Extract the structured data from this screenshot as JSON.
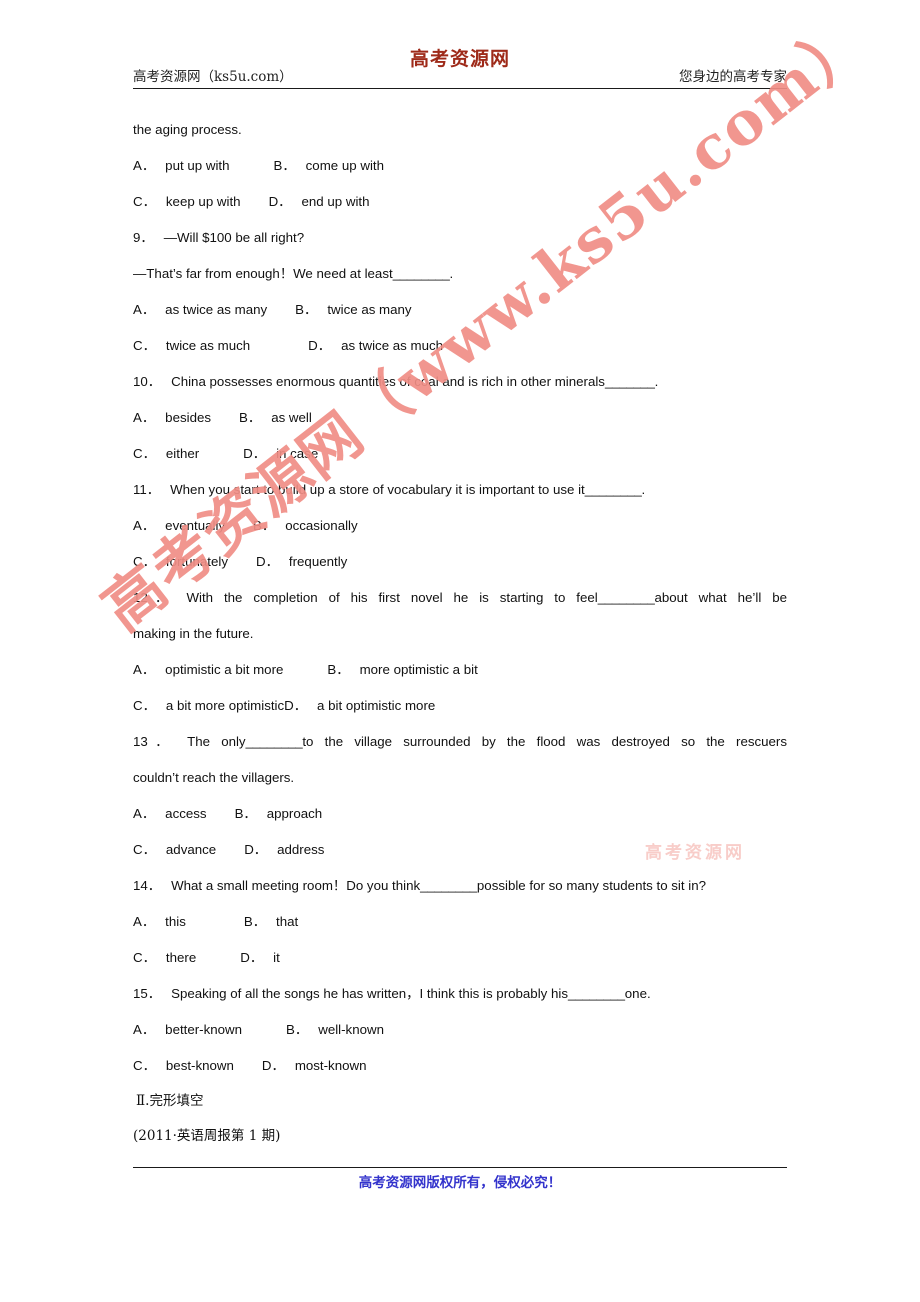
{
  "header": {
    "left_text": "高考资源网（ks5u.com）",
    "logo_text": "高考资源网",
    "right_text": "您身边的高考专家",
    "logo_color": "#9e2a19"
  },
  "watermark": {
    "main_text": "高考资源网（www.ks5u.com）",
    "faint_text": "高考资源网",
    "color": "#f08e86"
  },
  "content": {
    "carryover_line": "the aging process.",
    "questions": [
      {
        "number": "",
        "stem": "",
        "options": [
          {
            "label": "A．",
            "text": "put up with"
          },
          {
            "label": "B．",
            "text": "come up with"
          },
          {
            "label": "C．",
            "text": "keep up with"
          },
          {
            "label": "D．",
            "text": "end up with"
          }
        ]
      },
      {
        "number": "9．",
        "stem_line1": "—Will $100 be all right?",
        "stem_line2_a": "—That’s far from enough！We need at least",
        "stem_line2_blank": "________",
        "stem_line2_b": ".",
        "options": [
          {
            "label": "A．",
            "text": "as twice as many"
          },
          {
            "label": "B．",
            "text": "twice as many"
          },
          {
            "label": "C．",
            "text": "twice as much"
          },
          {
            "label": "D．",
            "text": "as twice as much"
          }
        ]
      },
      {
        "number": "10．",
        "stem_a": "China possesses enormous quantities of coal and is rich in other minerals",
        "stem_blank": "_______",
        "stem_b": ".",
        "options": [
          {
            "label": "A．",
            "text": "besides"
          },
          {
            "label": "B．",
            "text": "as well"
          },
          {
            "label": "C．",
            "text": "either"
          },
          {
            "label": "D．",
            "text": "in case"
          }
        ]
      },
      {
        "number": "11．",
        "stem_a": "When you start to build up a store of vocabulary it is important to use it",
        "stem_blank": "________",
        "stem_b": ".",
        "options": [
          {
            "label": "A．",
            "text": "eventually"
          },
          {
            "label": "B．",
            "text": "occasionally"
          },
          {
            "label": "C．",
            "text": "fortunately"
          },
          {
            "label": "D．",
            "text": "frequently"
          }
        ]
      },
      {
        "number": "12．",
        "stem_line1_a": "With the completion of his first novel he is starting to feel",
        "stem_line1_blank": "________",
        "stem_line1_b": "about what he’ll be",
        "stem_line2": "making in the future.",
        "options": [
          {
            "label": "A．",
            "text": "optimistic a bit more"
          },
          {
            "label": "B．",
            "text": "more optimistic a bit"
          },
          {
            "label": "C．",
            "text": "a bit more optimistic"
          },
          {
            "label": "D．",
            "text": "a bit optimistic more"
          }
        ]
      },
      {
        "number": "13．",
        "stem_line1_a": "The only",
        "stem_line1_blank": "________",
        "stem_line1_b": "to the village surrounded by the flood was destroyed so the rescuers",
        "stem_line2": "couldn’t reach the villagers.",
        "options": [
          {
            "label": "A．",
            "text": "access"
          },
          {
            "label": "B．",
            "text": "approach"
          },
          {
            "label": "C．",
            "text": "advance"
          },
          {
            "label": "D．",
            "text": "address"
          }
        ]
      },
      {
        "number": "14．",
        "stem_a": "What a small meeting room！Do you think",
        "stem_blank": "________",
        "stem_b": "possible for so many students to sit in?",
        "options": [
          {
            "label": "A．",
            "text": "this"
          },
          {
            "label": "B．",
            "text": "that"
          },
          {
            "label": "C．",
            "text": "there"
          },
          {
            "label": "D．",
            "text": "it"
          }
        ]
      },
      {
        "number": "15．",
        "stem_a": "Speaking of all the songs he has written，I think this is probably his",
        "stem_blank": "________",
        "stem_b": "one.",
        "options": [
          {
            "label": "A．",
            "text": "better-known"
          },
          {
            "label": "B．",
            "text": "well-known"
          },
          {
            "label": "C．",
            "text": "best-known"
          },
          {
            "label": "D．",
            "text": "most-known"
          }
        ]
      }
    ],
    "section_heading": "Ⅱ.完形填空",
    "source": "(2011·英语周报第 1 期)"
  },
  "footer": {
    "text": "高考资源网版权所有，侵权必究！",
    "color": "#3333cc"
  }
}
